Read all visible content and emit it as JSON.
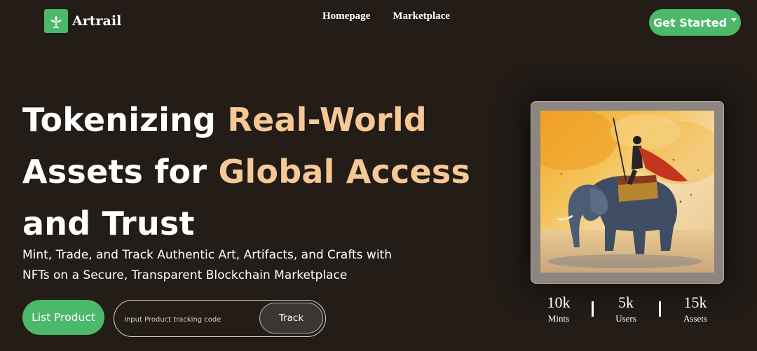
{
  "brand": {
    "name": "Artrail",
    "logo_icon": "lotus-leaf-icon",
    "accent_color": "#4cb96a"
  },
  "nav": {
    "items": [
      {
        "label": "Homepage"
      },
      {
        "label": "Marketplace"
      }
    ],
    "cta": {
      "label": "Get Started",
      "icon": "caret-down-icon"
    }
  },
  "hero": {
    "title_line1_a": "Tokenizing ",
    "title_line1_b": "Real-World",
    "title_line2_a": "Assets for ",
    "title_line2_b": "Global Access",
    "title_line3": "and Trust",
    "subtitle": "Mint, Trade, and Track Authentic Art, Artifacts, and Crafts with NFTs on a Secure, Transparent Blockchain Marketplace",
    "highlight_color": "#f6c895"
  },
  "actions": {
    "list_label": "List Product",
    "track_placeholder": "Input Product tracking code",
    "track_value": "",
    "track_label": "Track"
  },
  "artwork": {
    "subject": "watercolor painting of a warrior riding an elephant"
  },
  "stats": [
    {
      "value": "10k",
      "label": "Mints"
    },
    {
      "value": "5k",
      "label": "Users"
    },
    {
      "value": "15k",
      "label": "Assets"
    }
  ]
}
